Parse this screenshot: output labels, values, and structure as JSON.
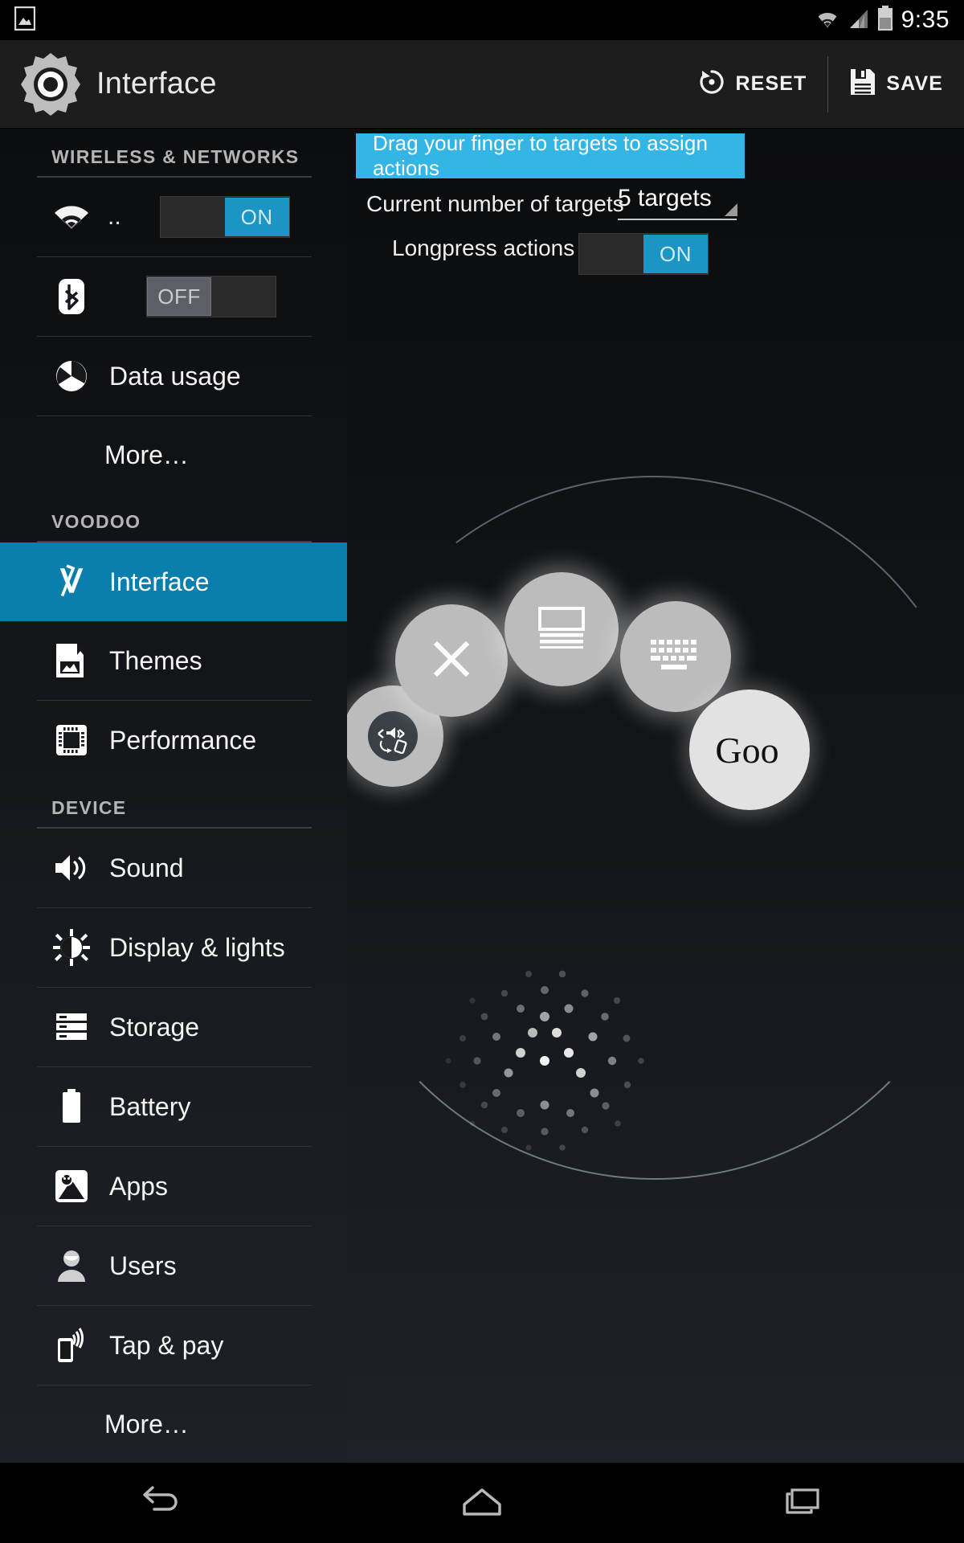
{
  "status_bar": {
    "notification_icon": "image-icon",
    "wifi_icon": "wifi-icon",
    "signal_icon": "cellular-signal-icon",
    "battery_icon": "battery-icon",
    "clock": "9:35"
  },
  "action_bar": {
    "app_icon": "gear-icon",
    "title": "Interface",
    "reset_label": "RESET",
    "reset_icon": "reset-icon",
    "save_label": "SAVE",
    "save_icon": "save-floppy-icon",
    "accent_blue": "#33b5e5",
    "background": "#1d1d1d"
  },
  "sidebar": {
    "selected_color": "#0a7fad",
    "sections": [
      {
        "header": "WIRELESS & NETWORKS",
        "items": [
          {
            "label": "",
            "icon": "wifi-icon",
            "kind": "toggle",
            "toggle_state": "ON",
            "sublabel": "..",
            "name": "wifi"
          },
          {
            "label": "",
            "icon": "bluetooth-icon",
            "kind": "toggle",
            "toggle_state": "OFF",
            "name": "bluetooth"
          },
          {
            "label": "Data usage",
            "icon": "data-usage-icon",
            "kind": "nav",
            "name": "data-usage"
          },
          {
            "label": "More…",
            "icon": "",
            "kind": "more",
            "name": "wireless-more"
          }
        ]
      },
      {
        "header": "VOODOO",
        "items": [
          {
            "label": "Interface",
            "icon": "voodoo-vx-icon",
            "kind": "nav",
            "selected": true,
            "name": "interface"
          },
          {
            "label": "Themes",
            "icon": "themes-picture-icon",
            "kind": "nav",
            "name": "themes"
          },
          {
            "label": "Performance",
            "icon": "cpu-chip-icon",
            "kind": "nav",
            "name": "performance"
          }
        ]
      },
      {
        "header": "DEVICE",
        "items": [
          {
            "label": "Sound",
            "icon": "speaker-icon",
            "kind": "nav",
            "name": "sound"
          },
          {
            "label": "Display & lights",
            "icon": "brightness-icon",
            "kind": "nav",
            "name": "display-lights"
          },
          {
            "label": "Storage",
            "icon": "storage-icon",
            "kind": "nav",
            "name": "storage"
          },
          {
            "label": "Battery",
            "icon": "battery-icon",
            "kind": "nav",
            "name": "battery"
          },
          {
            "label": "Apps",
            "icon": "android-apps-icon",
            "kind": "nav",
            "name": "apps"
          },
          {
            "label": "Users",
            "icon": "person-icon",
            "kind": "nav",
            "name": "users"
          },
          {
            "label": "Tap & pay",
            "icon": "nfc-tap-icon",
            "kind": "nav",
            "name": "tap-and-pay"
          },
          {
            "label": "More…",
            "icon": "",
            "kind": "more",
            "name": "device-more"
          }
        ]
      }
    ]
  },
  "content": {
    "banner": "Drag your finger to targets to assign actions",
    "targets_label": "Current number of targets",
    "targets_value": "5 targets",
    "longpress_label": "Longpress actions",
    "longpress_state": "ON",
    "ring_targets": [
      {
        "name": "ring-target-sound-rotate",
        "icon": "sound-rotation-icon"
      },
      {
        "name": "ring-target-close",
        "icon": "close-x-icon"
      },
      {
        "name": "ring-target-recents",
        "icon": "recent-apps-icon"
      },
      {
        "name": "ring-target-keyboard",
        "icon": "keyboard-icon"
      },
      {
        "name": "ring-target-google",
        "icon": "google-logo-icon",
        "text": "Goo"
      }
    ]
  },
  "nav_bar": {
    "back_label": "Back",
    "back_icon": "back-arrow-icon",
    "home_label": "Home",
    "home_icon": "home-icon",
    "recents_label": "Recents",
    "recents_icon": "recents-icon"
  }
}
